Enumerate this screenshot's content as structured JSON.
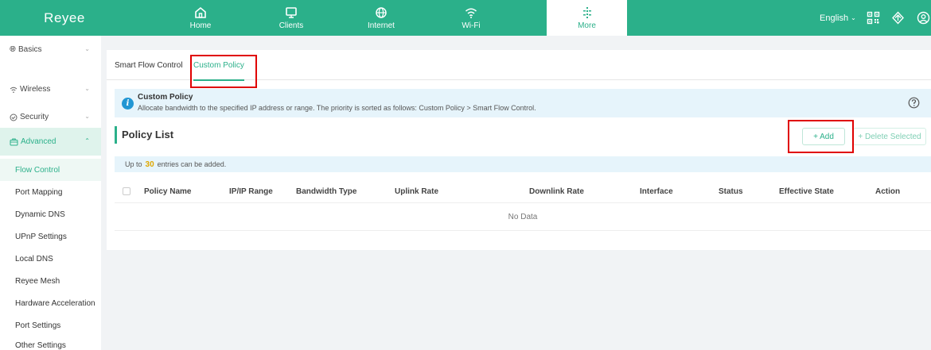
{
  "brand": {
    "logo": "Reyee",
    "accent": "#2bb08a"
  },
  "nav": [
    {
      "label": "Home",
      "icon": "home-icon"
    },
    {
      "label": "Clients",
      "icon": "monitor-icon"
    },
    {
      "label": "Internet",
      "icon": "globe-icon"
    },
    {
      "label": "Wi-Fi",
      "icon": "wifi-icon"
    },
    {
      "label": "More",
      "icon": "grid-icon",
      "active": true
    }
  ],
  "header": {
    "language": "English"
  },
  "sidebar": {
    "groups": [
      {
        "label": "Basics",
        "icon": "globe-icon"
      },
      {
        "label": "Wireless",
        "icon": "wifi-icon"
      },
      {
        "label": "Security",
        "icon": "shield-icon"
      },
      {
        "label": "Advanced",
        "icon": "briefcase-icon",
        "active": true
      }
    ],
    "items": [
      {
        "label": "Flow Control",
        "active": true
      },
      {
        "label": "Port Mapping"
      },
      {
        "label": "Dynamic DNS"
      },
      {
        "label": "UPnP Settings"
      },
      {
        "label": "Local DNS"
      },
      {
        "label": "Reyee Mesh"
      },
      {
        "label": "Hardware Acceleration"
      },
      {
        "label": "Port Settings"
      },
      {
        "label": "Other Settings"
      }
    ]
  },
  "tabs": [
    {
      "label": "Smart Flow Control"
    },
    {
      "label": "Custom Policy",
      "active": true
    }
  ],
  "info": {
    "title": "Custom Policy",
    "description": "Allocate bandwidth to the specified IP address or range. The priority is sorted as follows: Custom Policy > Smart Flow Control."
  },
  "policy_list": {
    "title": "Policy List",
    "add_label": "+ Add",
    "delete_label": "+ Delete Selected",
    "note_prefix": "Up to",
    "note_count": "30",
    "note_suffix": "entries can be added.",
    "columns": [
      "Policy Name",
      "IP/IP Range",
      "Bandwidth Type",
      "Uplink Rate",
      "Downlink Rate",
      "Interface",
      "Status",
      "Effective State",
      "Action"
    ],
    "empty_text": "No Data"
  }
}
